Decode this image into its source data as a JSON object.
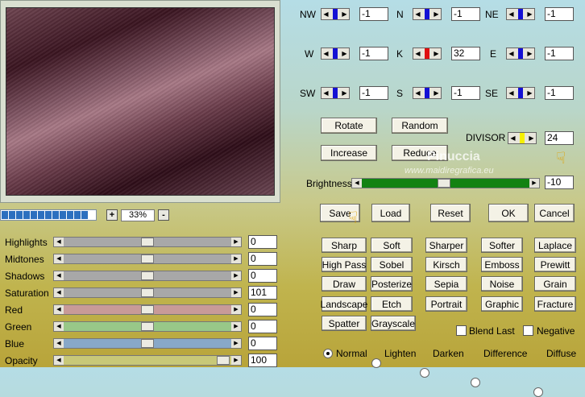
{
  "zoom": {
    "minus": "-",
    "plus": "+",
    "value": "33%"
  },
  "progress_segments": 12,
  "kernel": [
    {
      "id": "nw",
      "label": "NW",
      "value": "-1",
      "thumb": "blue"
    },
    {
      "id": "n",
      "label": "N",
      "value": "-1",
      "thumb": "blue"
    },
    {
      "id": "ne",
      "label": "NE",
      "value": "-1",
      "thumb": "blue"
    },
    {
      "id": "w",
      "label": "W",
      "value": "-1",
      "thumb": "blue"
    },
    {
      "id": "k",
      "label": "K",
      "value": "32",
      "thumb": "red"
    },
    {
      "id": "e",
      "label": "E",
      "value": "-1",
      "thumb": "blue"
    },
    {
      "id": "sw",
      "label": "SW",
      "value": "-1",
      "thumb": "blue"
    },
    {
      "id": "s",
      "label": "S",
      "value": "-1",
      "thumb": "blue"
    },
    {
      "id": "se",
      "label": "SE",
      "value": "-1",
      "thumb": "blue"
    }
  ],
  "buttons": {
    "rotate": "Rotate",
    "random": "Random",
    "increase": "Increase",
    "reduce": "Reduce",
    "save": "Save",
    "load": "Load",
    "reset": "Reset",
    "ok": "OK",
    "cancel": "Cancel"
  },
  "divisor": {
    "label": "DIVISOR",
    "value": "24"
  },
  "brightness": {
    "label": "Brightness",
    "value": "-10",
    "level": 0.49
  },
  "watermark": {
    "line1": "Pinuccia",
    "line2": "www.maidiregrafica.eu"
  },
  "filters": [
    [
      "Sharp",
      "Soft",
      "Sharper",
      "Softer",
      "Laplace"
    ],
    [
      "High Pass",
      "Sobel",
      "Kirsch",
      "Emboss",
      "Prewitt"
    ],
    [
      "Draw",
      "Posterize",
      "Sepia",
      "Noise",
      "Grain"
    ],
    [
      "Landscape",
      "Etch",
      "Portrait",
      "Graphic",
      "Fracture"
    ],
    [
      "Spatter",
      "Grayscale"
    ]
  ],
  "adjustments": [
    {
      "label": "Highlights",
      "value": "0",
      "level": 0.5,
      "track": "#a8a8a8"
    },
    {
      "label": "Midtones",
      "value": "0",
      "level": 0.5,
      "track": "#a8a8a8"
    },
    {
      "label": "Shadows",
      "value": "0",
      "level": 0.5,
      "track": "#a8a8a8"
    },
    {
      "label": "Saturation",
      "value": "101",
      "level": 0.5,
      "track": "#a8a8a8"
    },
    {
      "label": "Red",
      "value": "0",
      "level": 0.5,
      "track": "#c89a98"
    },
    {
      "label": "Green",
      "value": "0",
      "level": 0.5,
      "track": "#98c888"
    },
    {
      "label": "Blue",
      "value": "0",
      "level": 0.5,
      "track": "#88a8c8"
    },
    {
      "label": "Opacity",
      "value": "100",
      "level": 0.95,
      "track": "#c8c878"
    }
  ],
  "options": {
    "blend_last": "Blend Last",
    "negative": "Negative"
  },
  "modes": [
    {
      "label": "Normal",
      "selected": true
    },
    {
      "label": "Lighten",
      "selected": false
    },
    {
      "label": "Darken",
      "selected": false
    },
    {
      "label": "Difference",
      "selected": false
    },
    {
      "label": "Diffuse",
      "selected": false
    }
  ]
}
